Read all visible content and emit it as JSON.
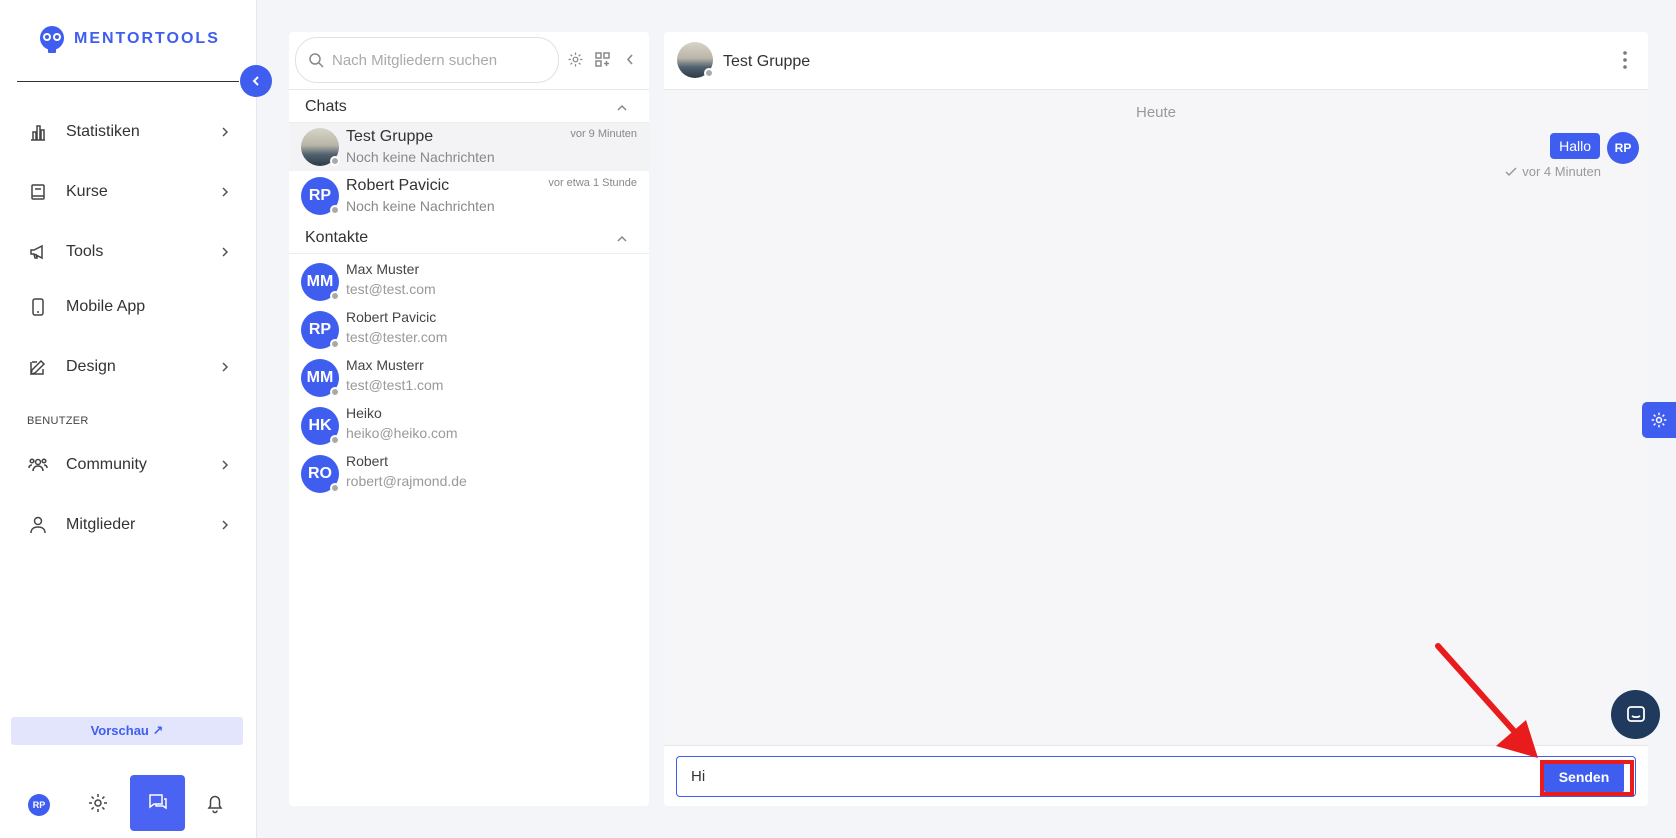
{
  "app": {
    "logo_text": "MENTORTOOLS"
  },
  "sidebar": {
    "items": [
      {
        "label": "Statistiken",
        "icon": "bar-chart-icon"
      },
      {
        "label": "Kurse",
        "icon": "book-icon"
      },
      {
        "label": "Tools",
        "icon": "megaphone-icon"
      },
      {
        "label": "Mobile App",
        "icon": "phone-icon"
      },
      {
        "label": "Design",
        "icon": "pencil-icon"
      }
    ],
    "section_label": "BENUTZER",
    "user_items": [
      {
        "label": "Community",
        "icon": "users-icon"
      },
      {
        "label": "Mitglieder",
        "icon": "person-icon"
      }
    ],
    "preview_label": "Vorschau ↗",
    "user_initials": "RP"
  },
  "chat_list": {
    "search_placeholder": "Nach Mitgliedern suchen",
    "chats_header": "Chats",
    "chats": [
      {
        "name": "Test Gruppe",
        "subtitle": "Noch keine Nachrichten",
        "time": "vor 9 Minuten",
        "initials": ""
      },
      {
        "name": "Robert Pavicic",
        "subtitle": "Noch keine Nachrichten",
        "time": "vor etwa 1 Stunde",
        "initials": "RP"
      }
    ],
    "contacts_header": "Kontakte",
    "contacts": [
      {
        "initials": "MM",
        "name": "Max Muster",
        "email": "test@test.com"
      },
      {
        "initials": "RP",
        "name": "Robert Pavicic",
        "email": "test@tester.com"
      },
      {
        "initials": "MM",
        "name": "Max Musterr",
        "email": "test@test1.com"
      },
      {
        "initials": "HK",
        "name": "Heiko",
        "email": "heiko@heiko.com"
      },
      {
        "initials": "RO",
        "name": "Robert",
        "email": "robert@rajmond.de"
      }
    ]
  },
  "conversation": {
    "title": "Test Gruppe",
    "day_label": "Heute",
    "messages": [
      {
        "text": "Hallo",
        "initials": "RP",
        "time": "vor 4 Minuten"
      }
    ],
    "input_value": "Hi",
    "send_label": "Senden"
  },
  "colors": {
    "accent": "#3f5ef0",
    "highlight": "#e81c1c"
  }
}
